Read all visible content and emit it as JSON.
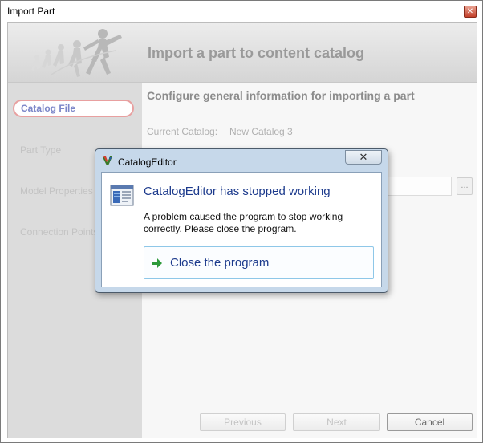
{
  "window": {
    "title": "Import Part",
    "close_icon": "close-icon"
  },
  "banner": {
    "title": "Import a part to content catalog",
    "art_icon": "running-figures-icon"
  },
  "sidebar": {
    "items": [
      {
        "label": "Catalog File",
        "active": true
      },
      {
        "label": "Part Type",
        "active": false
      },
      {
        "label": "Model Properties",
        "active": false
      },
      {
        "label": "Connection Points",
        "active": false
      }
    ]
  },
  "content": {
    "heading": "Configure general information for importing a part",
    "current_catalog_label": "Current Catalog:",
    "current_catalog_value": "New Catalog 3",
    "browse_label": "...",
    "file_path_value": ""
  },
  "footer": {
    "previous_label": "Previous",
    "next_label": "Next",
    "cancel_label": "Cancel"
  },
  "dialog": {
    "title": "CatalogEditor",
    "heading": "CatalogEditor has stopped working",
    "message": "A problem caused the program to stop working correctly. Please close the program.",
    "action_label": "Close the program",
    "close_glyph": "✕",
    "action_icon": "green-arrow-icon",
    "app_icon": "catalog-editor-icon",
    "status_icon": "application-window-icon"
  },
  "colors": {
    "active_nav_text": "#7b86c8",
    "active_nav_border": "#e8a0a0",
    "dialog_heading": "#1c3a8c",
    "dialog_frame": "#c6d8ea",
    "action_border": "#8ec7e8"
  }
}
